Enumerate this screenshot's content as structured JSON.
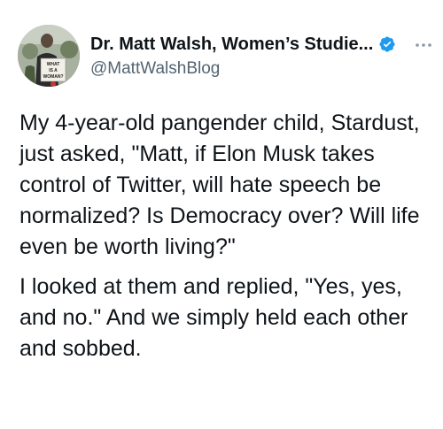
{
  "tweet": {
    "author": {
      "display_name": "Dr. Matt Walsh, Women’s Studie...",
      "handle": "@MattWalshBlog",
      "verified": true,
      "verified_icon": "verified-badge-icon",
      "avatar_sign_text": [
        "WHAT",
        "IS A",
        "WOMAN?"
      ]
    },
    "more_icon": "ellipsis-icon",
    "paragraphs": [
      "My 4-year-old pangender child, Stardust, just asked, \"Matt, if Elon Musk takes control of Twitter, will hate speech be normalized? Is Democracy over? Will life even be worth living?\"",
      "I looked at them and replied, \"Yes, yes, and no.\" And we simply held each other and sobbed."
    ]
  },
  "colors": {
    "text": "#0f1419",
    "secondary_text": "#536471",
    "verified_blue": "#1d9bf0"
  }
}
